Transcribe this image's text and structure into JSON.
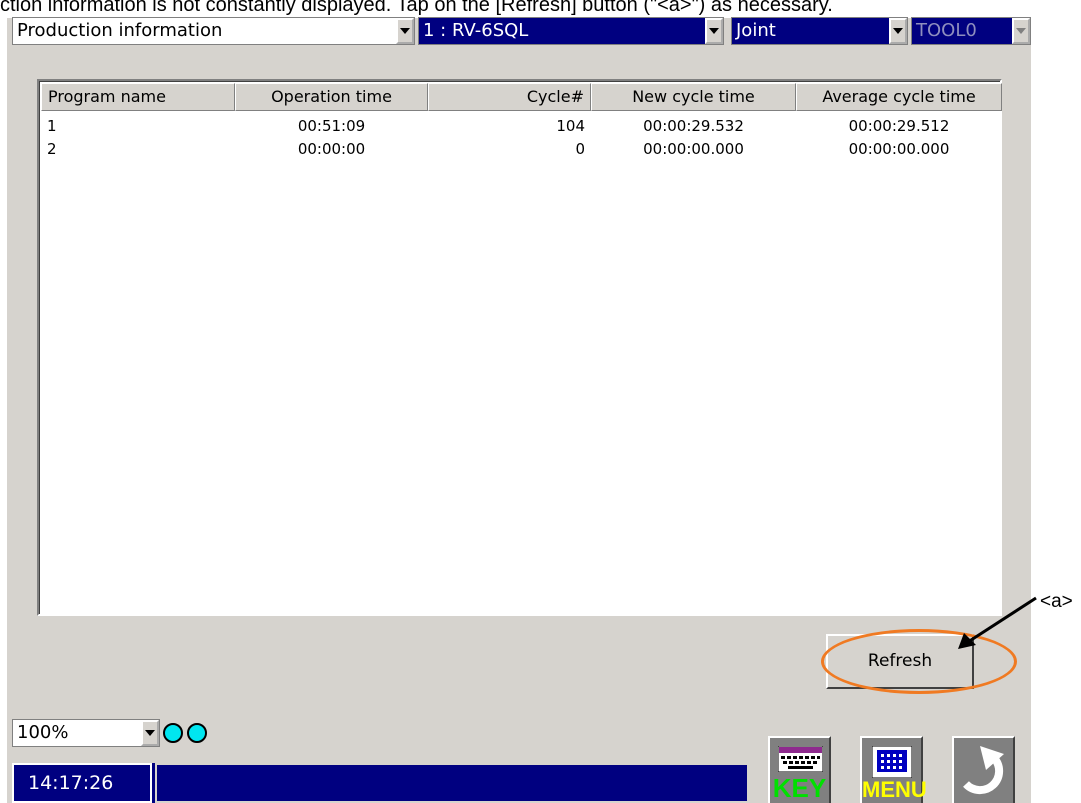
{
  "caption": "ction information is not constantly displayed. Tap on the [Refresh] button (\"<a>\") as necessary.",
  "header": {
    "screen_select": "Production information",
    "robot_select": "1 : RV-6SQL",
    "jog_mode": "Joint",
    "tool_select": "TOOL0"
  },
  "table": {
    "columns": [
      "Program name",
      "Operation time",
      "Cycle#",
      "New cycle time",
      "Average cycle time"
    ],
    "rows": [
      [
        "1",
        "00:51:09",
        "104",
        "00:00:29.532",
        "00:00:29.512"
      ],
      [
        "2",
        "00:00:00",
        "0",
        "00:00:00.000",
        "00:00:00.000"
      ]
    ]
  },
  "refresh_label": "Refresh",
  "annotation_label": "<a>",
  "footer": {
    "speed": "100%",
    "clock": "14:17:26",
    "key_label": "KEY",
    "menu_label": "MENU"
  },
  "colors": {
    "panel": "#d6d3ce",
    "selection_blue": "#000080",
    "highlight_orange": "#f07a22",
    "status_dot": "#00e6f0"
  },
  "icons": [
    "dropdown-arrow-icon",
    "keyboard-icon",
    "menu-grid-icon",
    "return-arrow-icon"
  ]
}
